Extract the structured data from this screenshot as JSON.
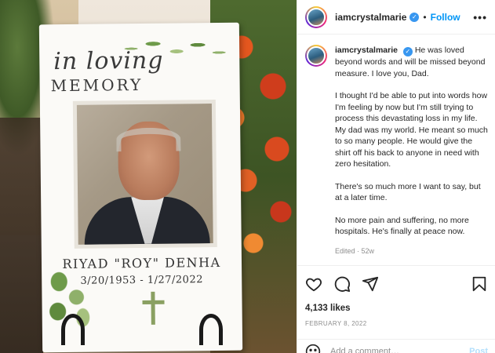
{
  "photo": {
    "sign": {
      "script_line": "in loving",
      "heading": "MEMORY",
      "name": "RIYAD \"ROY\" DENHA",
      "dates": "3/20/1953 - 1/27/2022"
    }
  },
  "header": {
    "username": "iamcrystalmarie",
    "separator": "•",
    "follow_label": "Follow",
    "more_label": "•••"
  },
  "caption": {
    "username": "iamcrystalmarie",
    "lead": "He was loved beyond words and will be missed beyond measure. I love you, Dad.",
    "paragraphs": [
      "I thought I'd be able to put into words how I'm feeling by now but I'm still trying to process this devastating loss in my life. My dad was my world. He meant so much to so many people. He would give the shirt off his back to anyone in need with zero hesitation.",
      "There's so much more I want to say, but at a later time.",
      "No more pain and suffering, no more hospitals. He's finally at peace now."
    ],
    "meta": "Edited · 52w"
  },
  "actions": {
    "icons": [
      "heart-icon",
      "comment-icon",
      "share-icon",
      "bookmark-icon"
    ],
    "likes": "4,133 likes",
    "date": "FEBRUARY 8, 2022"
  },
  "comment": {
    "placeholder": "Add a comment…",
    "post_label": "Post"
  },
  "colors": {
    "link_blue": "#0095f6",
    "verified_blue": "#3897f0",
    "muted": "#8e8e8e",
    "disabled_post": "#b2dffc"
  }
}
